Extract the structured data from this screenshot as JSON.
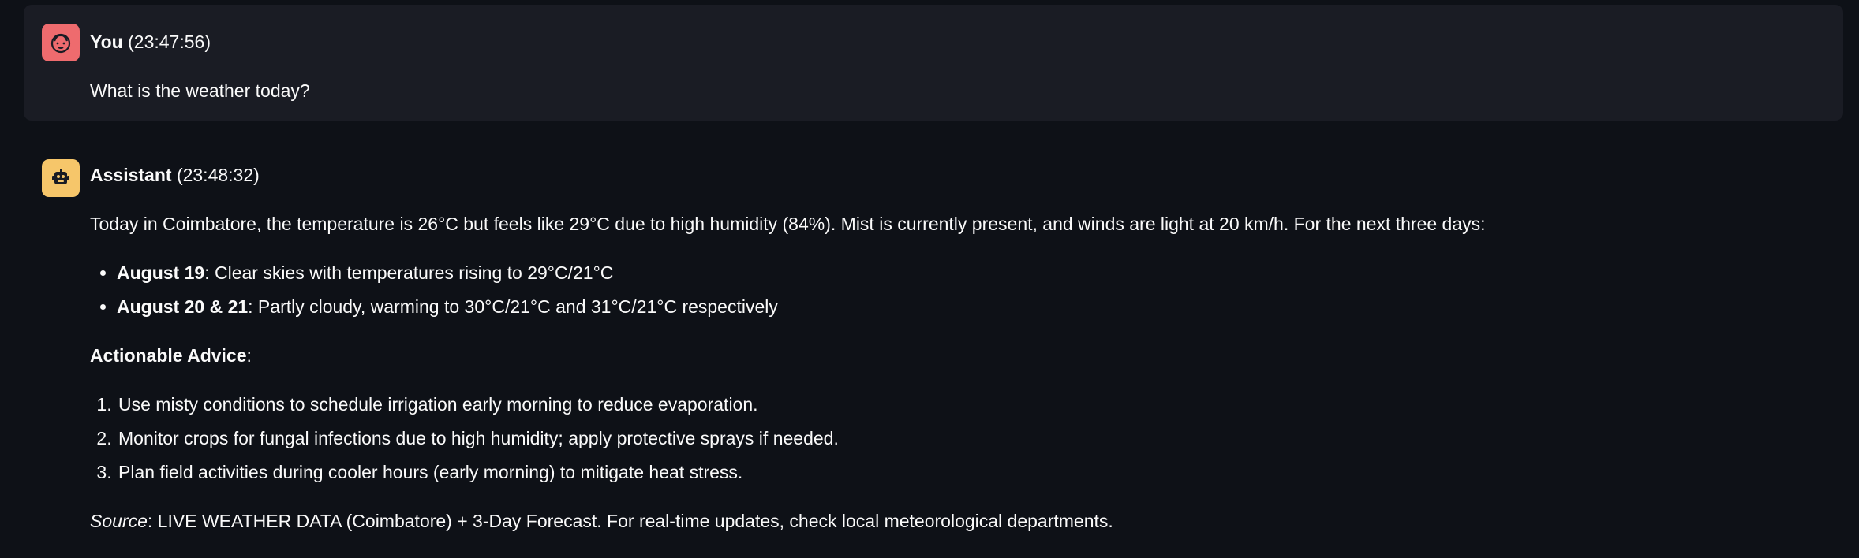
{
  "messages": {
    "user": {
      "name": "You",
      "time": "(23:47:56)",
      "text": "What is the weather today?",
      "avatar_icon": "face-icon",
      "avatar_color": "#ee6b6e"
    },
    "assistant": {
      "name": "Assistant",
      "time": "(23:48:32)",
      "avatar_icon": "robot-icon",
      "avatar_color": "#f6c66a",
      "intro": "Today in Coimbatore, the temperature is 26°C but feels like 29°C due to high humidity (84%). Mist is currently present, and winds are light at 20 km/h. For the next three days:",
      "forecast": [
        {
          "label": "August 19",
          "text": ": Clear skies with temperatures rising to 29°C/21°C"
        },
        {
          "label": "August 20 & 21",
          "text": ": Partly cloudy, warming to 30°C/21°C and 31°C/21°C respectively"
        }
      ],
      "advice_heading": "Actionable Advice",
      "advice_colon": ":",
      "advice": [
        "Use misty conditions to schedule irrigation early morning to reduce evaporation.",
        "Monitor crops for fungal infections due to high humidity; apply protective sprays if needed.",
        "Plan field activities during cooler hours (early morning) to mitigate heat stress."
      ],
      "source_label": "Source",
      "source_text": ": LIVE WEATHER DATA (Coimbatore) + 3-Day Forecast. For real-time updates, check local meteorological departments."
    }
  },
  "colors": {
    "background": "#0e1117",
    "user_bubble": "#1a1c24",
    "text": "#fafafa"
  }
}
